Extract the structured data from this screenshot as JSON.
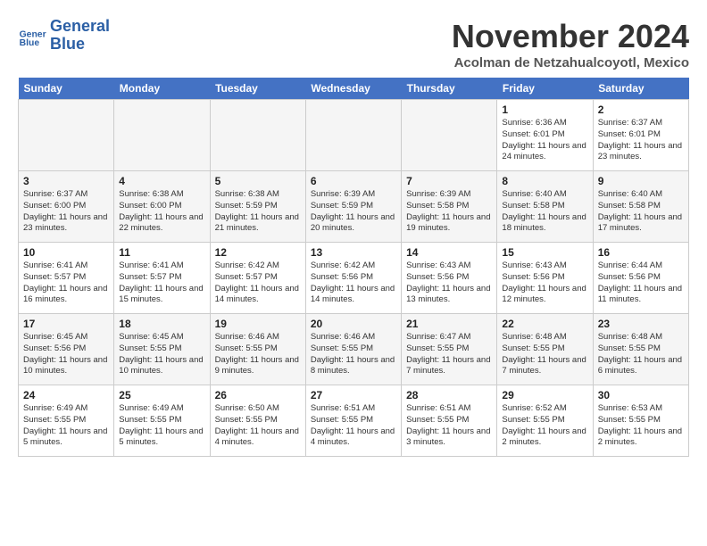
{
  "header": {
    "logo_line1": "General",
    "logo_line2": "Blue",
    "month": "November 2024",
    "location": "Acolman de Netzahualcoyotl, Mexico"
  },
  "days_of_week": [
    "Sunday",
    "Monday",
    "Tuesday",
    "Wednesday",
    "Thursday",
    "Friday",
    "Saturday"
  ],
  "weeks": [
    [
      {
        "day": "",
        "info": ""
      },
      {
        "day": "",
        "info": ""
      },
      {
        "day": "",
        "info": ""
      },
      {
        "day": "",
        "info": ""
      },
      {
        "day": "",
        "info": ""
      },
      {
        "day": "1",
        "info": "Sunrise: 6:36 AM\nSunset: 6:01 PM\nDaylight: 11 hours and 24 minutes."
      },
      {
        "day": "2",
        "info": "Sunrise: 6:37 AM\nSunset: 6:01 PM\nDaylight: 11 hours and 23 minutes."
      }
    ],
    [
      {
        "day": "3",
        "info": "Sunrise: 6:37 AM\nSunset: 6:00 PM\nDaylight: 11 hours and 23 minutes."
      },
      {
        "day": "4",
        "info": "Sunrise: 6:38 AM\nSunset: 6:00 PM\nDaylight: 11 hours and 22 minutes."
      },
      {
        "day": "5",
        "info": "Sunrise: 6:38 AM\nSunset: 5:59 PM\nDaylight: 11 hours and 21 minutes."
      },
      {
        "day": "6",
        "info": "Sunrise: 6:39 AM\nSunset: 5:59 PM\nDaylight: 11 hours and 20 minutes."
      },
      {
        "day": "7",
        "info": "Sunrise: 6:39 AM\nSunset: 5:58 PM\nDaylight: 11 hours and 19 minutes."
      },
      {
        "day": "8",
        "info": "Sunrise: 6:40 AM\nSunset: 5:58 PM\nDaylight: 11 hours and 18 minutes."
      },
      {
        "day": "9",
        "info": "Sunrise: 6:40 AM\nSunset: 5:58 PM\nDaylight: 11 hours and 17 minutes."
      }
    ],
    [
      {
        "day": "10",
        "info": "Sunrise: 6:41 AM\nSunset: 5:57 PM\nDaylight: 11 hours and 16 minutes."
      },
      {
        "day": "11",
        "info": "Sunrise: 6:41 AM\nSunset: 5:57 PM\nDaylight: 11 hours and 15 minutes."
      },
      {
        "day": "12",
        "info": "Sunrise: 6:42 AM\nSunset: 5:57 PM\nDaylight: 11 hours and 14 minutes."
      },
      {
        "day": "13",
        "info": "Sunrise: 6:42 AM\nSunset: 5:56 PM\nDaylight: 11 hours and 14 minutes."
      },
      {
        "day": "14",
        "info": "Sunrise: 6:43 AM\nSunset: 5:56 PM\nDaylight: 11 hours and 13 minutes."
      },
      {
        "day": "15",
        "info": "Sunrise: 6:43 AM\nSunset: 5:56 PM\nDaylight: 11 hours and 12 minutes."
      },
      {
        "day": "16",
        "info": "Sunrise: 6:44 AM\nSunset: 5:56 PM\nDaylight: 11 hours and 11 minutes."
      }
    ],
    [
      {
        "day": "17",
        "info": "Sunrise: 6:45 AM\nSunset: 5:56 PM\nDaylight: 11 hours and 10 minutes."
      },
      {
        "day": "18",
        "info": "Sunrise: 6:45 AM\nSunset: 5:55 PM\nDaylight: 11 hours and 10 minutes."
      },
      {
        "day": "19",
        "info": "Sunrise: 6:46 AM\nSunset: 5:55 PM\nDaylight: 11 hours and 9 minutes."
      },
      {
        "day": "20",
        "info": "Sunrise: 6:46 AM\nSunset: 5:55 PM\nDaylight: 11 hours and 8 minutes."
      },
      {
        "day": "21",
        "info": "Sunrise: 6:47 AM\nSunset: 5:55 PM\nDaylight: 11 hours and 7 minutes."
      },
      {
        "day": "22",
        "info": "Sunrise: 6:48 AM\nSunset: 5:55 PM\nDaylight: 11 hours and 7 minutes."
      },
      {
        "day": "23",
        "info": "Sunrise: 6:48 AM\nSunset: 5:55 PM\nDaylight: 11 hours and 6 minutes."
      }
    ],
    [
      {
        "day": "24",
        "info": "Sunrise: 6:49 AM\nSunset: 5:55 PM\nDaylight: 11 hours and 5 minutes."
      },
      {
        "day": "25",
        "info": "Sunrise: 6:49 AM\nSunset: 5:55 PM\nDaylight: 11 hours and 5 minutes."
      },
      {
        "day": "26",
        "info": "Sunrise: 6:50 AM\nSunset: 5:55 PM\nDaylight: 11 hours and 4 minutes."
      },
      {
        "day": "27",
        "info": "Sunrise: 6:51 AM\nSunset: 5:55 PM\nDaylight: 11 hours and 4 minutes."
      },
      {
        "day": "28",
        "info": "Sunrise: 6:51 AM\nSunset: 5:55 PM\nDaylight: 11 hours and 3 minutes."
      },
      {
        "day": "29",
        "info": "Sunrise: 6:52 AM\nSunset: 5:55 PM\nDaylight: 11 hours and 2 minutes."
      },
      {
        "day": "30",
        "info": "Sunrise: 6:53 AM\nSunset: 5:55 PM\nDaylight: 11 hours and 2 minutes."
      }
    ]
  ]
}
